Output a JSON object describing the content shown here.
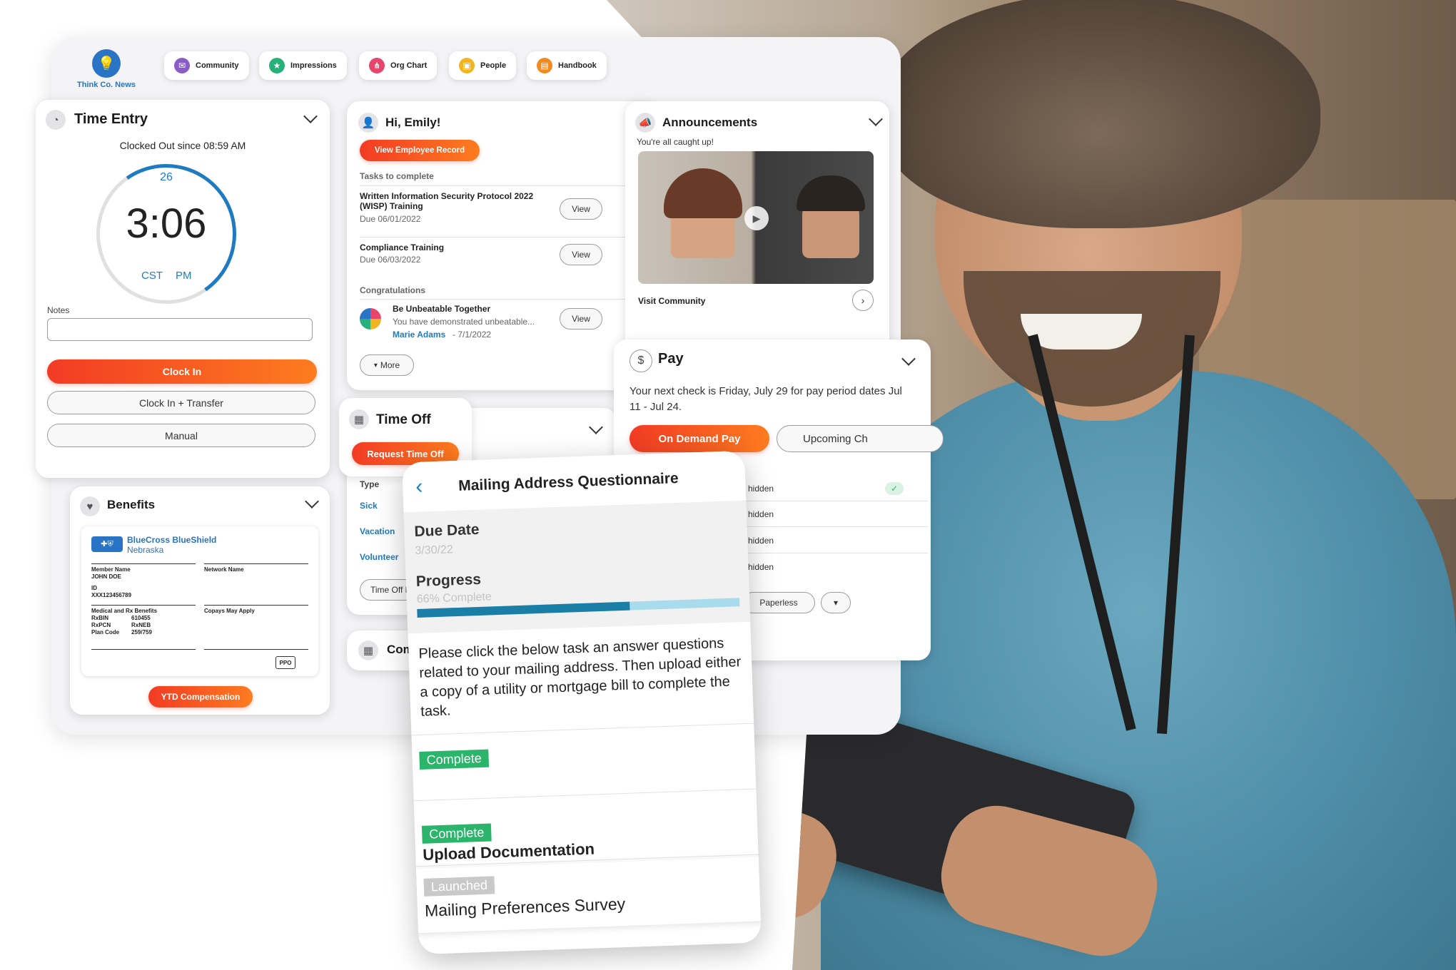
{
  "nav": {
    "logo_text": "Think Co. News",
    "items": [
      {
        "label": "Community",
        "icon": "community-icon",
        "color": "#8a5cc7"
      },
      {
        "label": "Impressions",
        "icon": "star-icon",
        "color": "#28b07a"
      },
      {
        "label": "Org Chart",
        "icon": "org-chart-icon",
        "color": "#e8456b"
      },
      {
        "label": "People",
        "icon": "people-icon",
        "color": "#f2b51f"
      },
      {
        "label": "Handbook",
        "icon": "handbook-icon",
        "color": "#f28a1f"
      }
    ]
  },
  "time_entry": {
    "title": "Time Entry",
    "status": "Clocked Out since 08:59 AM",
    "seconds": "26",
    "time": "3:06",
    "timezone": "CST",
    "meridiem": "PM",
    "notes_label": "Notes",
    "notes_value": "",
    "clock_in": "Clock In",
    "clock_in_transfer": "Clock In + Transfer",
    "manual": "Manual"
  },
  "hi": {
    "title": "Hi, Emily!",
    "view_record": "View Employee Record",
    "tasks_heading": "Tasks to complete",
    "tasks": [
      {
        "name_line1": "Written Information Security Protocol 2022",
        "name_line2": "(WISP) Training",
        "due": "Due 06/01/2022",
        "action": "View"
      },
      {
        "name_line1": "Compliance Training",
        "name_line2": "",
        "due": "Due 06/03/2022",
        "action": "View"
      }
    ],
    "congrats_heading": "Congratulations",
    "congrats": {
      "title": "Be Unbeatable Together",
      "text": "You have demonstrated unbeatable...",
      "author": "Marie Adams",
      "date": "- 7/1/2022",
      "action": "View"
    },
    "more": "More"
  },
  "announcements": {
    "title": "Announcements",
    "status": "You're all caught up!",
    "visit": "Visit Community"
  },
  "pay": {
    "title": "Pay",
    "text": "Your next check is Friday, July 29 for pay period dates Jul 11 - Jul 24.",
    "on_demand": "On Demand Pay",
    "upcoming": "Upcoming Ch",
    "hidden_rows": [
      "hidden",
      "hidden",
      "hidden",
      "hidden"
    ],
    "paperless": "Paperless"
  },
  "time_off": {
    "title": "Time Off",
    "request": "Request Time Off",
    "type_label": "Type",
    "types": [
      "Sick",
      "Vacation",
      "Volunteer"
    ],
    "history": "Time Off H"
  },
  "comp": {
    "title": "Comp"
  },
  "benefits": {
    "title": "Benefits",
    "insurer": "BlueCross BlueShield",
    "region": "Nebraska",
    "member_name_label": "Member Name",
    "member_name": "JOHN DOE",
    "network_label": "Network Name",
    "id_label": "ID",
    "id_value": "XXX123456789",
    "medical_label": "Medical and Rx Benefits",
    "copays_label": "Copays May Apply",
    "rxbin_label": "RxBIN",
    "rxbin": "610455",
    "rxpcn_label": "RxPCN",
    "rxpcn": "RxNEB",
    "plan_label": "Plan Code",
    "plan": "259/759",
    "ppo": "PPO",
    "ytd": "YTD Compensation"
  },
  "questionnaire": {
    "title": "Mailing Address Questionnaire",
    "due_label": "Due Date",
    "due_value": "3/30/22",
    "progress_label": "Progress",
    "progress_text": "66% Complete",
    "progress": 0.66,
    "instructions": "Please click the below task an answer questions related to your mailing address. Then upload either a copy of a utility or mortgage bill to complete the task.",
    "tasks": [
      {
        "status": "Complete",
        "name": ""
      },
      {
        "status": "Complete",
        "name": "Upload Documentation"
      },
      {
        "status": "Launched",
        "name": "Mailing Preferences Survey"
      }
    ]
  },
  "colors": {
    "accent_red": "#f23b24",
    "accent_orange": "#fd7c1f",
    "brand_blue": "#1e7bc1",
    "complete_green": "#2bb56b",
    "launched_gray": "#c9c9c9"
  }
}
